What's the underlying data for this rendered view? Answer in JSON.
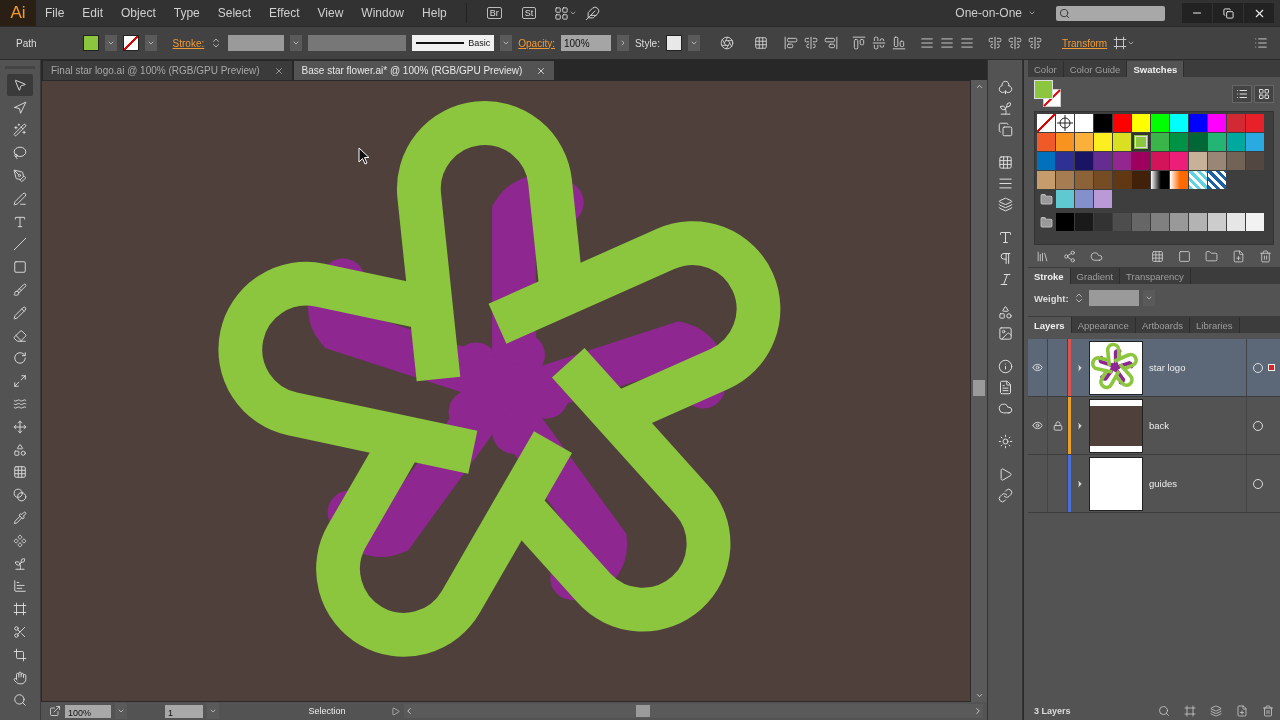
{
  "menu_bar": {
    "logo": "Ai",
    "menus": [
      "File",
      "Edit",
      "Object",
      "Type",
      "Select",
      "Effect",
      "View",
      "Window",
      "Help"
    ],
    "bridge": "Br",
    "stock": "St",
    "workspace": "One-on-One"
  },
  "control_bar": {
    "selection": "Path",
    "stroke_label": "Stroke:",
    "brush": "Basic",
    "opacity_label": "Opacity:",
    "opacity": "100%",
    "style_label": "Style:",
    "transform": "Transform"
  },
  "tools": [
    {
      "selected": true
    },
    {
      "selected": false
    },
    {
      "selected": false
    },
    {
      "selected": false
    },
    {
      "selected": false
    },
    {
      "selected": false
    },
    {
      "selected": false
    },
    {
      "selected": false
    },
    {
      "selected": false
    },
    {
      "selected": false
    },
    {
      "selected": false
    },
    {
      "selected": false
    },
    {
      "selected": false
    },
    {
      "selected": false
    },
    {
      "selected": false
    },
    {
      "selected": false
    },
    {
      "selected": false
    },
    {
      "selected": false
    },
    {
      "selected": false
    },
    {
      "selected": false
    },
    {
      "selected": false
    },
    {
      "selected": false
    },
    {
      "selected": false
    },
    {
      "selected": false
    },
    {
      "selected": false
    },
    {
      "selected": false
    },
    {
      "selected": false
    },
    {
      "selected": false
    }
  ],
  "documents": [
    {
      "title": "Final star logo.ai @ 100% (RGB/GPU Preview)",
      "selected": false
    },
    {
      "title": "Base star flower.ai* @ 100% (RGB/GPU Preview)",
      "selected": true
    }
  ],
  "status_bar": {
    "zoom": "100%",
    "artboard": "1",
    "tool": "Selection"
  },
  "swatches_panel": {
    "tabs": [
      {
        "label": "Color",
        "selected": false
      },
      {
        "label": "Color Guide",
        "selected": false
      },
      {
        "label": "Swatches",
        "selected": true
      }
    ],
    "rows": [
      [
        {
          "kind": "none",
          "selected": false
        },
        {
          "kind": "registration",
          "selected": false
        },
        {
          "kind": "solid",
          "color": "#ffffff",
          "selected": false
        },
        {
          "kind": "solid",
          "color": "#000000",
          "selected": false
        },
        {
          "kind": "solid",
          "color": "#ff0000",
          "selected": false
        },
        {
          "kind": "solid",
          "color": "#ffff00",
          "selected": false
        },
        {
          "kind": "solid",
          "color": "#00ff00",
          "selected": false
        },
        {
          "kind": "solid",
          "color": "#00ffff",
          "selected": false
        },
        {
          "kind": "solid",
          "color": "#0000ff",
          "selected": false
        },
        {
          "kind": "solid",
          "color": "#ff00ff",
          "selected": false
        },
        {
          "kind": "solid",
          "color": "#d12a35",
          "selected": false
        },
        {
          "kind": "solid",
          "color": "#e8202a",
          "selected": false
        }
      ],
      [
        {
          "kind": "solid",
          "color": "#f05a28",
          "selected": false
        },
        {
          "kind": "solid",
          "color": "#f7931e",
          "selected": false
        },
        {
          "kind": "solid",
          "color": "#fbb03b",
          "selected": false
        },
        {
          "kind": "solid",
          "color": "#fcee21",
          "selected": false
        },
        {
          "kind": "solid",
          "color": "#d9e021",
          "selected": false
        },
        {
          "kind": "solid",
          "color": "#8cc63f",
          "selected": true
        },
        {
          "kind": "solid",
          "color": "#39b54a",
          "selected": false
        },
        {
          "kind": "solid",
          "color": "#009245",
          "selected": false
        },
        {
          "kind": "solid",
          "color": "#006837",
          "selected": false
        },
        {
          "kind": "solid",
          "color": "#22b573",
          "selected": false
        },
        {
          "kind": "solid",
          "color": "#00a99d",
          "selected": false
        },
        {
          "kind": "solid",
          "color": "#29abe2",
          "selected": false
        }
      ],
      [
        {
          "kind": "solid",
          "color": "#0071bc",
          "selected": false
        },
        {
          "kind": "solid",
          "color": "#2e3192",
          "selected": false
        },
        {
          "kind": "solid",
          "color": "#1b1464",
          "selected": false
        },
        {
          "kind": "solid",
          "color": "#662d91",
          "selected": false
        },
        {
          "kind": "solid",
          "color": "#93278f",
          "selected": false
        },
        {
          "kind": "solid",
          "color": "#9e005d",
          "selected": false
        },
        {
          "kind": "solid",
          "color": "#d4145a",
          "selected": false
        },
        {
          "kind": "solid",
          "color": "#ed1e79",
          "selected": false
        },
        {
          "kind": "solid",
          "color": "#c7b299",
          "selected": false
        },
        {
          "kind": "solid",
          "color": "#998675",
          "selected": false
        },
        {
          "kind": "solid",
          "color": "#736357",
          "selected": false
        },
        {
          "kind": "solid",
          "color": "#534741",
          "selected": false
        }
      ],
      [
        {
          "kind": "solid",
          "color": "#c69c6d",
          "selected": false
        },
        {
          "kind": "solid",
          "color": "#a67c52",
          "selected": false
        },
        {
          "kind": "solid",
          "color": "#8c6239",
          "selected": false
        },
        {
          "kind": "solid",
          "color": "#754c24",
          "selected": false
        },
        {
          "kind": "solid",
          "color": "#603813",
          "selected": false
        },
        {
          "kind": "solid",
          "color": "#42210b",
          "selected": false
        },
        {
          "kind": "gradient",
          "color": "#000000",
          "selected": false
        },
        {
          "kind": "gradient",
          "color": "#ff6a00",
          "selected": false
        },
        {
          "kind": "pattern",
          "color": "#5fd3e0",
          "selected": false
        },
        {
          "kind": "pattern",
          "color": "#1f5fa8",
          "selected": false
        }
      ]
    ],
    "groups": [
      [
        {
          "kind": "solid",
          "color": "#5fc8d0",
          "selected": false
        },
        {
          "kind": "solid",
          "color": "#8490cb",
          "selected": false
        },
        {
          "kind": "solid",
          "color": "#b99ad6",
          "selected": false
        }
      ],
      [
        {
          "kind": "solid",
          "color": "#000000",
          "selected": false
        },
        {
          "kind": "solid",
          "color": "#1a1a1a",
          "selected": false
        },
        {
          "kind": "solid",
          "color": "#333333",
          "selected": false
        },
        {
          "kind": "solid",
          "color": "#4d4d4d",
          "selected": false
        },
        {
          "kind": "solid",
          "color": "#666666",
          "selected": false
        },
        {
          "kind": "solid",
          "color": "#808080",
          "selected": false
        },
        {
          "kind": "solid",
          "color": "#999999",
          "selected": false
        },
        {
          "kind": "solid",
          "color": "#b3b3b3",
          "selected": false
        },
        {
          "kind": "solid",
          "color": "#cccccc",
          "selected": false
        },
        {
          "kind": "solid",
          "color": "#e6e6e6",
          "selected": false
        },
        {
          "kind": "solid",
          "color": "#f2f2f2",
          "selected": false
        }
      ]
    ]
  },
  "stroke_panel": {
    "tabs": [
      {
        "label": "Stroke",
        "selected": true
      },
      {
        "label": "Gradient",
        "selected": false
      },
      {
        "label": "Transparency",
        "selected": false
      }
    ],
    "weight_label": "Weight:"
  },
  "layers_panel": {
    "tabs": [
      {
        "label": "Layers",
        "selected": true
      },
      {
        "label": "Appearance",
        "selected": false
      },
      {
        "label": "Artboards",
        "selected": false
      },
      {
        "label": "Libraries",
        "selected": false
      }
    ],
    "layers": [
      {
        "name": "star logo",
        "color": "#d9534f",
        "visible": true,
        "locked": false,
        "selected": true,
        "has_selection": true,
        "kind": "artwork"
      },
      {
        "name": "back",
        "color": "#e8a02a",
        "visible": true,
        "locked": true,
        "selected": false,
        "has_selection": false,
        "kind": "background"
      },
      {
        "name": "guides",
        "color": "#4a6fd8",
        "visible": false,
        "locked": false,
        "selected": false,
        "has_selection": false,
        "kind": "blank"
      }
    ],
    "count": "3 Layers"
  }
}
